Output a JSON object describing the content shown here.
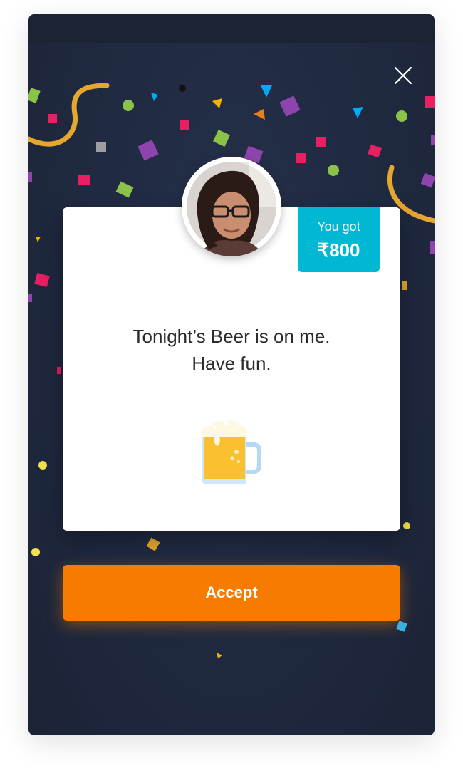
{
  "dialog": {
    "close_icon": "close-icon",
    "avatar_icon": "user-photo",
    "reward": {
      "label": "You got",
      "amount": "₹800",
      "color": "#00b8d4"
    },
    "message": {
      "line1": "Tonight’s Beer is on me.",
      "line2": "Have fun."
    },
    "emoji_icon": "beer-mug-icon",
    "accept_label": "Accept",
    "accept_color": "#f57c00"
  },
  "theme": {
    "background": "#1f2940",
    "card": "#ffffff"
  }
}
